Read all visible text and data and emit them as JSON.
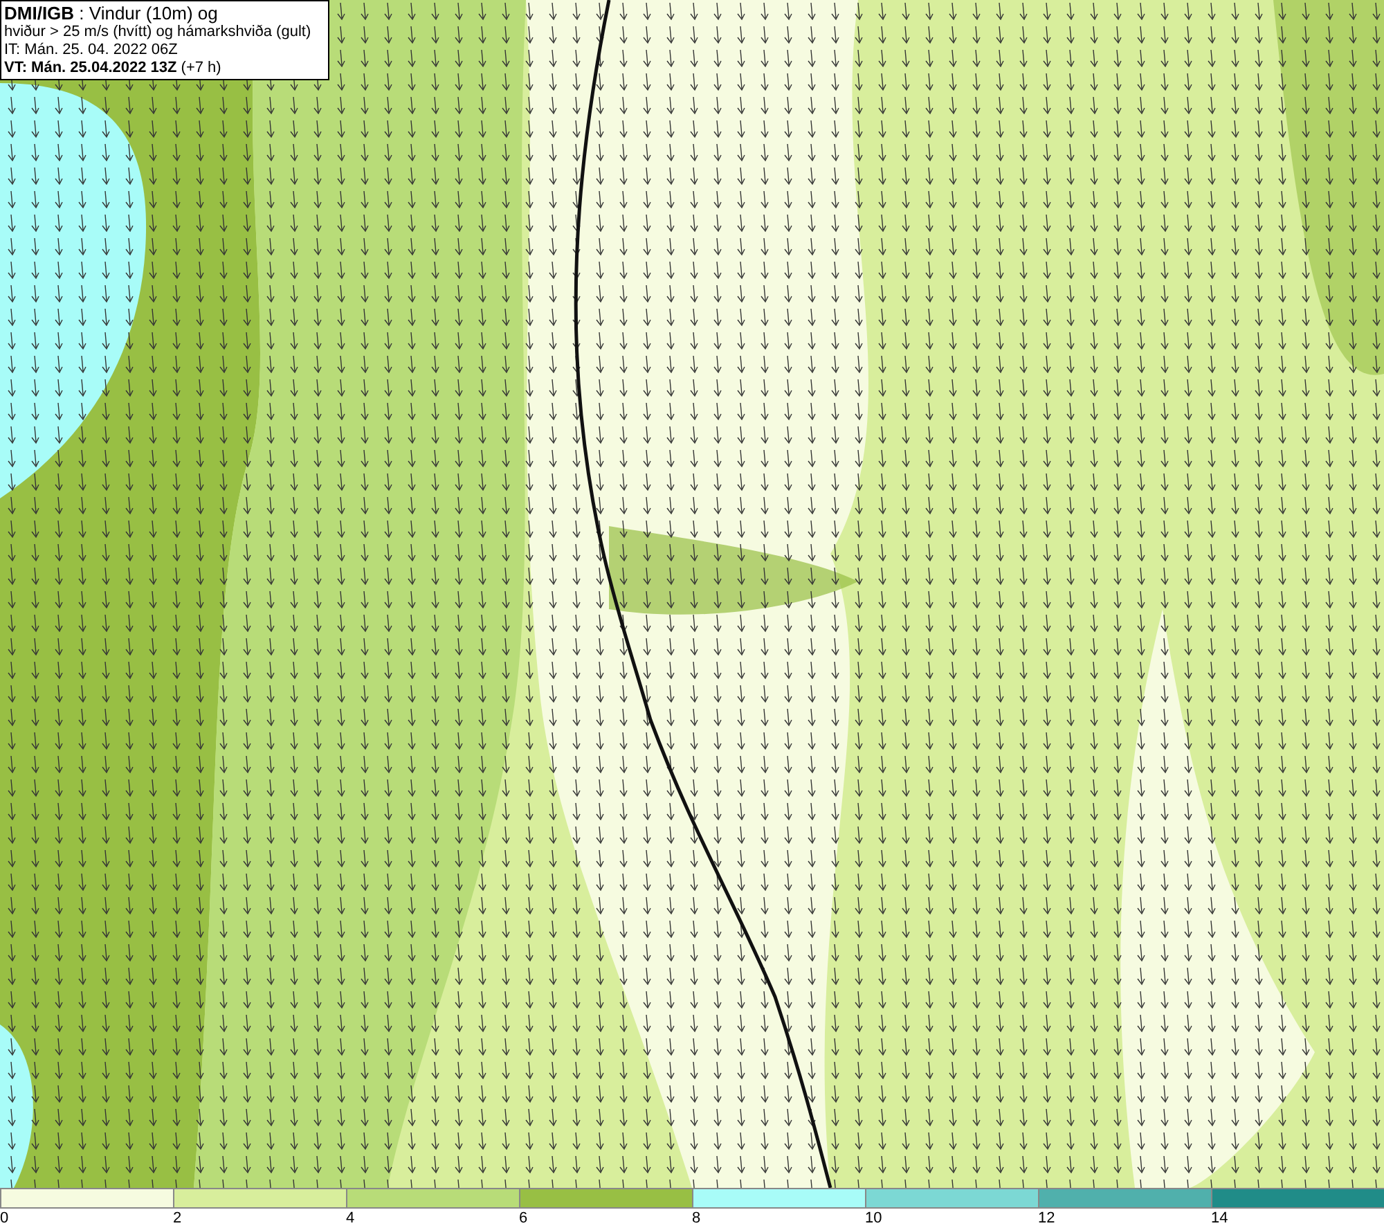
{
  "header": {
    "lines": [
      "**DMI/IGB** : Vindur (10m) og",
      "hviður > 25 m/s (hvítt) og hámarkshviða (gult)",
      "IT: Mán. 25. 04. 2022 06Z",
      "**VT: Mán. 25.04.2022 13Z** (+7 h)"
    ]
  },
  "legend": {
    "segments": [
      {
        "color": "#f6fbe0",
        "label": "0"
      },
      {
        "color": "#d8ee9c",
        "label": "2"
      },
      {
        "color": "#b8dc78",
        "label": "4"
      },
      {
        "color": "#98bf44",
        "label": "6"
      },
      {
        "color": "#a8fcf8",
        "label": "8"
      },
      {
        "color": "#7cd8d4",
        "label": "10"
      },
      {
        "color": "#50b0ac",
        "label": "12"
      },
      {
        "color": "#208c88",
        "label": "14"
      }
    ]
  }
}
